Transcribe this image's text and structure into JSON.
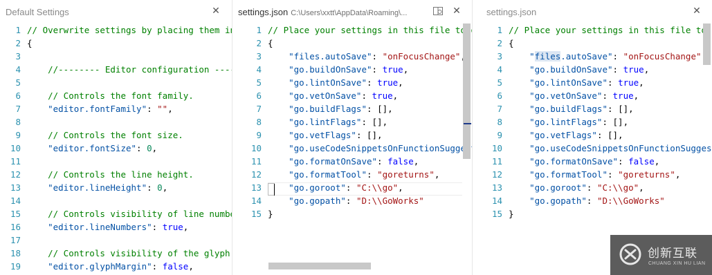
{
  "panes": [
    {
      "tab": {
        "title": "Default Settings",
        "path": "",
        "close_icon": "close-icon"
      },
      "lines": [
        {
          "n": "1",
          "tokens": [
            {
              "t": "// Overwrite settings by placing them into your settings file.",
              "c": "comment"
            }
          ]
        },
        {
          "n": "2",
          "tokens": [
            {
              "t": "{",
              "c": "punc"
            }
          ]
        },
        {
          "n": "3",
          "tokens": []
        },
        {
          "n": "4",
          "tokens": [
            {
              "t": "    //-------- Editor configuration --------",
              "c": "comment"
            }
          ]
        },
        {
          "n": "5",
          "tokens": []
        },
        {
          "n": "6",
          "tokens": [
            {
              "t": "    // Controls the font family.",
              "c": "comment"
            }
          ]
        },
        {
          "n": "7",
          "tokens": [
            {
              "t": "    \"editor.fontFamily\"",
              "c": "key"
            },
            {
              "t": ": ",
              "c": "punc"
            },
            {
              "t": "\"\"",
              "c": "str"
            },
            {
              "t": ",",
              "c": "punc"
            }
          ]
        },
        {
          "n": "8",
          "tokens": []
        },
        {
          "n": "9",
          "tokens": [
            {
              "t": "    // Controls the font size.",
              "c": "comment"
            }
          ]
        },
        {
          "n": "10",
          "tokens": [
            {
              "t": "    \"editor.fontSize\"",
              "c": "key"
            },
            {
              "t": ": ",
              "c": "punc"
            },
            {
              "t": "0",
              "c": "num"
            },
            {
              "t": ",",
              "c": "punc"
            }
          ]
        },
        {
          "n": "11",
          "tokens": []
        },
        {
          "n": "12",
          "tokens": [
            {
              "t": "    // Controls the line height.",
              "c": "comment"
            }
          ]
        },
        {
          "n": "13",
          "tokens": [
            {
              "t": "    \"editor.lineHeight\"",
              "c": "key"
            },
            {
              "t": ": ",
              "c": "punc"
            },
            {
              "t": "0",
              "c": "num"
            },
            {
              "t": ",",
              "c": "punc"
            }
          ]
        },
        {
          "n": "14",
          "tokens": []
        },
        {
          "n": "15",
          "tokens": [
            {
              "t": "    // Controls visibility of line numbers",
              "c": "comment"
            }
          ]
        },
        {
          "n": "16",
          "tokens": [
            {
              "t": "    \"editor.lineNumbers\"",
              "c": "key"
            },
            {
              "t": ": ",
              "c": "punc"
            },
            {
              "t": "true",
              "c": "bool"
            },
            {
              "t": ",",
              "c": "punc"
            }
          ]
        },
        {
          "n": "17",
          "tokens": []
        },
        {
          "n": "18",
          "tokens": [
            {
              "t": "    // Controls visibility of the glyph margin",
              "c": "comment"
            }
          ]
        },
        {
          "n": "19",
          "tokens": [
            {
              "t": "    \"editor.glyphMargin\"",
              "c": "key"
            },
            {
              "t": ": ",
              "c": "punc"
            },
            {
              "t": "false",
              "c": "bool"
            },
            {
              "t": ",",
              "c": "punc"
            }
          ]
        }
      ]
    },
    {
      "tab": {
        "title": "settings.json",
        "path": "C:\\Users\\xxtt\\AppData\\Roaming\\...",
        "close_icon": "close-icon",
        "split_icon": "split-editor-icon"
      },
      "lines": [
        {
          "n": "1",
          "tokens": [
            {
              "t": "// Place your settings in this file to overwrite the default settings",
              "c": "comment"
            }
          ]
        },
        {
          "n": "2",
          "tokens": [
            {
              "t": "{",
              "c": "punc"
            }
          ]
        },
        {
          "n": "3",
          "tokens": [
            {
              "t": "    \"files.autoSave\"",
              "c": "key"
            },
            {
              "t": ": ",
              "c": "punc"
            },
            {
              "t": "\"onFocusChange\"",
              "c": "str"
            },
            {
              "t": ",",
              "c": "punc"
            }
          ]
        },
        {
          "n": "4",
          "tokens": [
            {
              "t": "    \"go.buildOnSave\"",
              "c": "key"
            },
            {
              "t": ": ",
              "c": "punc"
            },
            {
              "t": "true",
              "c": "bool"
            },
            {
              "t": ",",
              "c": "punc"
            }
          ]
        },
        {
          "n": "5",
          "tokens": [
            {
              "t": "    \"go.lintOnSave\"",
              "c": "key"
            },
            {
              "t": ": ",
              "c": "punc"
            },
            {
              "t": "true",
              "c": "bool"
            },
            {
              "t": ",",
              "c": "punc"
            }
          ]
        },
        {
          "n": "6",
          "tokens": [
            {
              "t": "    \"go.vetOnSave\"",
              "c": "key"
            },
            {
              "t": ": ",
              "c": "punc"
            },
            {
              "t": "true",
              "c": "bool"
            },
            {
              "t": ",",
              "c": "punc"
            }
          ]
        },
        {
          "n": "7",
          "tokens": [
            {
              "t": "    \"go.buildFlags\"",
              "c": "key"
            },
            {
              "t": ": ",
              "c": "punc"
            },
            {
              "t": "[],",
              "c": "punc"
            }
          ]
        },
        {
          "n": "8",
          "tokens": [
            {
              "t": "    \"go.lintFlags\"",
              "c": "key"
            },
            {
              "t": ": ",
              "c": "punc"
            },
            {
              "t": "[],",
              "c": "punc"
            }
          ]
        },
        {
          "n": "9",
          "tokens": [
            {
              "t": "    \"go.vetFlags\"",
              "c": "key"
            },
            {
              "t": ": ",
              "c": "punc"
            },
            {
              "t": "[],",
              "c": "punc"
            }
          ]
        },
        {
          "n": "10",
          "tokens": [
            {
              "t": "    \"go.useCodeSnippetsOnFunctionSuggest\"",
              "c": "key"
            },
            {
              "t": ": ",
              "c": "punc"
            },
            {
              "t": "false",
              "c": "bool"
            },
            {
              "t": ",",
              "c": "punc"
            }
          ]
        },
        {
          "n": "11",
          "tokens": [
            {
              "t": "    \"go.formatOnSave\"",
              "c": "key"
            },
            {
              "t": ": ",
              "c": "punc"
            },
            {
              "t": "false",
              "c": "bool"
            },
            {
              "t": ",",
              "c": "punc"
            }
          ]
        },
        {
          "n": "12",
          "tokens": [
            {
              "t": "    \"go.formatTool\"",
              "c": "key"
            },
            {
              "t": ": ",
              "c": "punc"
            },
            {
              "t": "\"goreturns\"",
              "c": "str"
            },
            {
              "t": ",",
              "c": "punc"
            }
          ]
        },
        {
          "n": "13",
          "tokens": [
            {
              "t": "    \"go.goroot\"",
              "c": "key"
            },
            {
              "t": ": ",
              "c": "punc"
            },
            {
              "t": "\"C:\\\\go\"",
              "c": "str"
            },
            {
              "t": ",",
              "c": "punc"
            }
          ]
        },
        {
          "n": "14",
          "tokens": [
            {
              "t": "    \"go.gopath\"",
              "c": "key"
            },
            {
              "t": ": ",
              "c": "punc"
            },
            {
              "t": "\"D:\\\\GoWorks\"",
              "c": "str"
            }
          ]
        },
        {
          "n": "15",
          "tokens": [
            {
              "t": "}",
              "c": "punc"
            }
          ]
        }
      ]
    },
    {
      "tab": {
        "title": "settings.json",
        "path": "",
        "close_icon": "close-icon"
      },
      "lines": [
        {
          "n": "1",
          "tokens": [
            {
              "t": "// Place your settings in this file to overwrite the default settings",
              "c": "comment"
            }
          ]
        },
        {
          "n": "2",
          "tokens": [
            {
              "t": "{",
              "c": "punc"
            }
          ]
        },
        {
          "n": "3",
          "tokens": [
            {
              "t": "    ",
              "c": "punc"
            },
            {
              "t": "\"",
              "c": "key"
            },
            {
              "t": "files",
              "c": "key hl"
            },
            {
              "t": ".autoSave\"",
              "c": "key"
            },
            {
              "t": ": ",
              "c": "punc"
            },
            {
              "t": "\"onFocusChange\"",
              "c": "str"
            },
            {
              "t": ",",
              "c": "punc"
            }
          ]
        },
        {
          "n": "4",
          "tokens": [
            {
              "t": "    \"go.buildOnSave\"",
              "c": "key"
            },
            {
              "t": ": ",
              "c": "punc"
            },
            {
              "t": "true",
              "c": "bool"
            },
            {
              "t": ",",
              "c": "punc"
            }
          ]
        },
        {
          "n": "5",
          "tokens": [
            {
              "t": "    \"go.lintOnSave\"",
              "c": "key"
            },
            {
              "t": ": ",
              "c": "punc"
            },
            {
              "t": "true",
              "c": "bool"
            },
            {
              "t": ",",
              "c": "punc"
            }
          ]
        },
        {
          "n": "6",
          "tokens": [
            {
              "t": "    \"go.vetOnSave\"",
              "c": "key"
            },
            {
              "t": ": ",
              "c": "punc"
            },
            {
              "t": "true",
              "c": "bool"
            },
            {
              "t": ",",
              "c": "punc"
            }
          ]
        },
        {
          "n": "7",
          "tokens": [
            {
              "t": "    \"go.buildFlags\"",
              "c": "key"
            },
            {
              "t": ": ",
              "c": "punc"
            },
            {
              "t": "[],",
              "c": "punc"
            }
          ]
        },
        {
          "n": "8",
          "tokens": [
            {
              "t": "    \"go.lintFlags\"",
              "c": "key"
            },
            {
              "t": ": ",
              "c": "punc"
            },
            {
              "t": "[],",
              "c": "punc"
            }
          ]
        },
        {
          "n": "9",
          "tokens": [
            {
              "t": "    \"go.vetFlags\"",
              "c": "key"
            },
            {
              "t": ": ",
              "c": "punc"
            },
            {
              "t": "[],",
              "c": "punc"
            }
          ]
        },
        {
          "n": "10",
          "tokens": [
            {
              "t": "    \"go.useCodeSnippetsOnFunctionSuggest\"",
              "c": "key"
            },
            {
              "t": ": ",
              "c": "punc"
            },
            {
              "t": "false",
              "c": "bool"
            },
            {
              "t": ",",
              "c": "punc"
            }
          ]
        },
        {
          "n": "11",
          "tokens": [
            {
              "t": "    \"go.formatOnSave\"",
              "c": "key"
            },
            {
              "t": ": ",
              "c": "punc"
            },
            {
              "t": "false",
              "c": "bool"
            },
            {
              "t": ",",
              "c": "punc"
            }
          ]
        },
        {
          "n": "12",
          "tokens": [
            {
              "t": "    \"go.formatTool\"",
              "c": "key"
            },
            {
              "t": ": ",
              "c": "punc"
            },
            {
              "t": "\"goreturns\"",
              "c": "str"
            },
            {
              "t": ",",
              "c": "punc"
            }
          ]
        },
        {
          "n": "13",
          "tokens": [
            {
              "t": "    \"go.goroot\"",
              "c": "key"
            },
            {
              "t": ": ",
              "c": "punc"
            },
            {
              "t": "\"C:\\\\go\"",
              "c": "str"
            },
            {
              "t": ",",
              "c": "punc"
            }
          ]
        },
        {
          "n": "14",
          "tokens": [
            {
              "t": "    \"go.gopath\"",
              "c": "key"
            },
            {
              "t": ": ",
              "c": "punc"
            },
            {
              "t": "\"D:\\\\GoWorks\"",
              "c": "str"
            }
          ]
        },
        {
          "n": "15",
          "tokens": [
            {
              "t": "}",
              "c": "punc"
            }
          ]
        }
      ]
    }
  ],
  "watermark": {
    "brand_cn": "创新互联",
    "brand_en": "CHUANG XIN HU LIAN",
    "logo_icon": "brand-logo-icon"
  },
  "colors": {
    "line_number": "#2b91af",
    "comment": "#008000",
    "key": "#0451a5",
    "string": "#a31515",
    "number": "#09885a",
    "keyword": "#0000ff",
    "highlight": "#dbe6f3"
  }
}
